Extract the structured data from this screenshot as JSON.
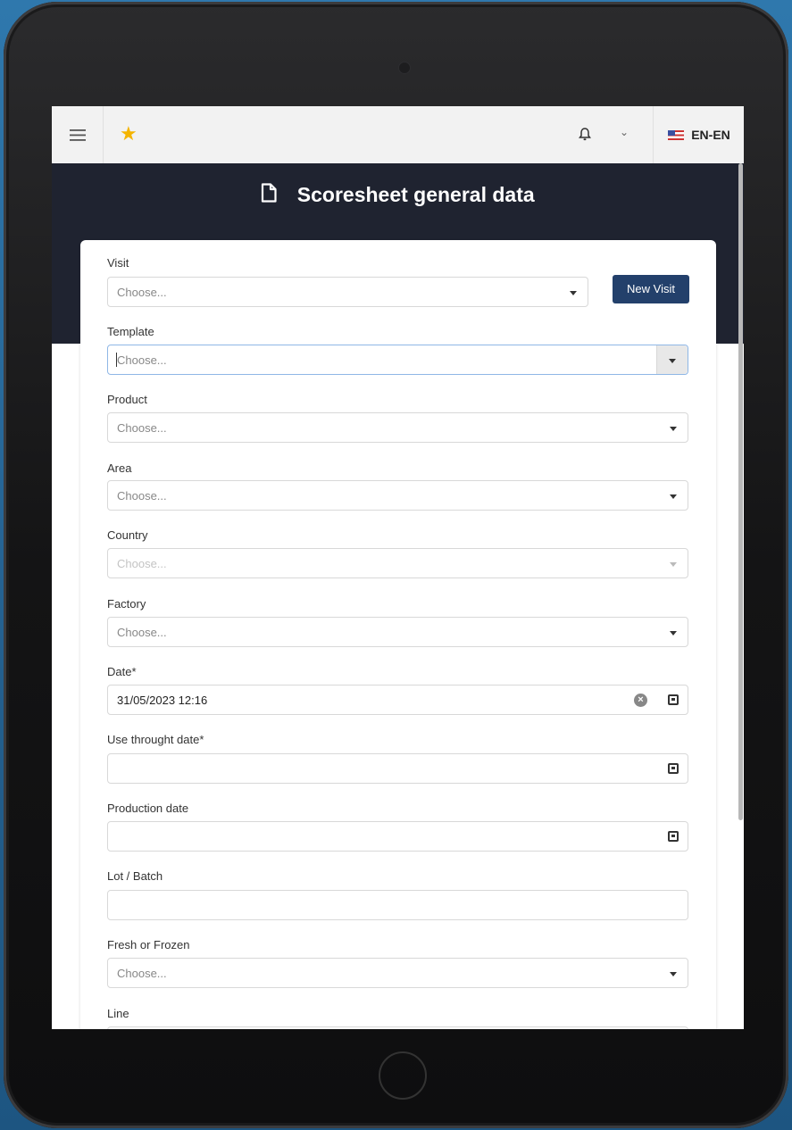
{
  "topbar": {
    "language": "EN-EN"
  },
  "page": {
    "title": "Scoresheet general data"
  },
  "form": {
    "visit": {
      "label": "Visit",
      "placeholder": "Choose...",
      "button": "New Visit"
    },
    "template": {
      "label": "Template",
      "placeholder": "Choose..."
    },
    "product": {
      "label": "Product",
      "placeholder": "Choose..."
    },
    "area": {
      "label": "Area",
      "placeholder": "Choose..."
    },
    "country": {
      "label": "Country",
      "placeholder": "Choose..."
    },
    "factory": {
      "label": "Factory",
      "placeholder": "Choose..."
    },
    "date": {
      "label": "Date*",
      "value": "31/05/2023 12:16"
    },
    "use_through_date": {
      "label": "Use throught date*",
      "value": ""
    },
    "production_date": {
      "label": "Production date",
      "value": ""
    },
    "lot_batch": {
      "label": "Lot / Batch",
      "value": ""
    },
    "fresh_or_frozen": {
      "label": "Fresh or Frozen",
      "placeholder": "Choose..."
    },
    "line": {
      "label": "Line"
    }
  },
  "icons": {
    "menu": "hamburger-icon",
    "favorite": "star-icon",
    "notifications": "bell-icon",
    "dropdown": "chevron-down-icon",
    "language_flag": "us-flag-icon",
    "document": "document-icon",
    "calendar": "calendar-icon",
    "clear": "clear-icon"
  },
  "colors": {
    "header_dark": "#1f2330",
    "primary_button": "#23406b",
    "star": "#f4b400"
  }
}
